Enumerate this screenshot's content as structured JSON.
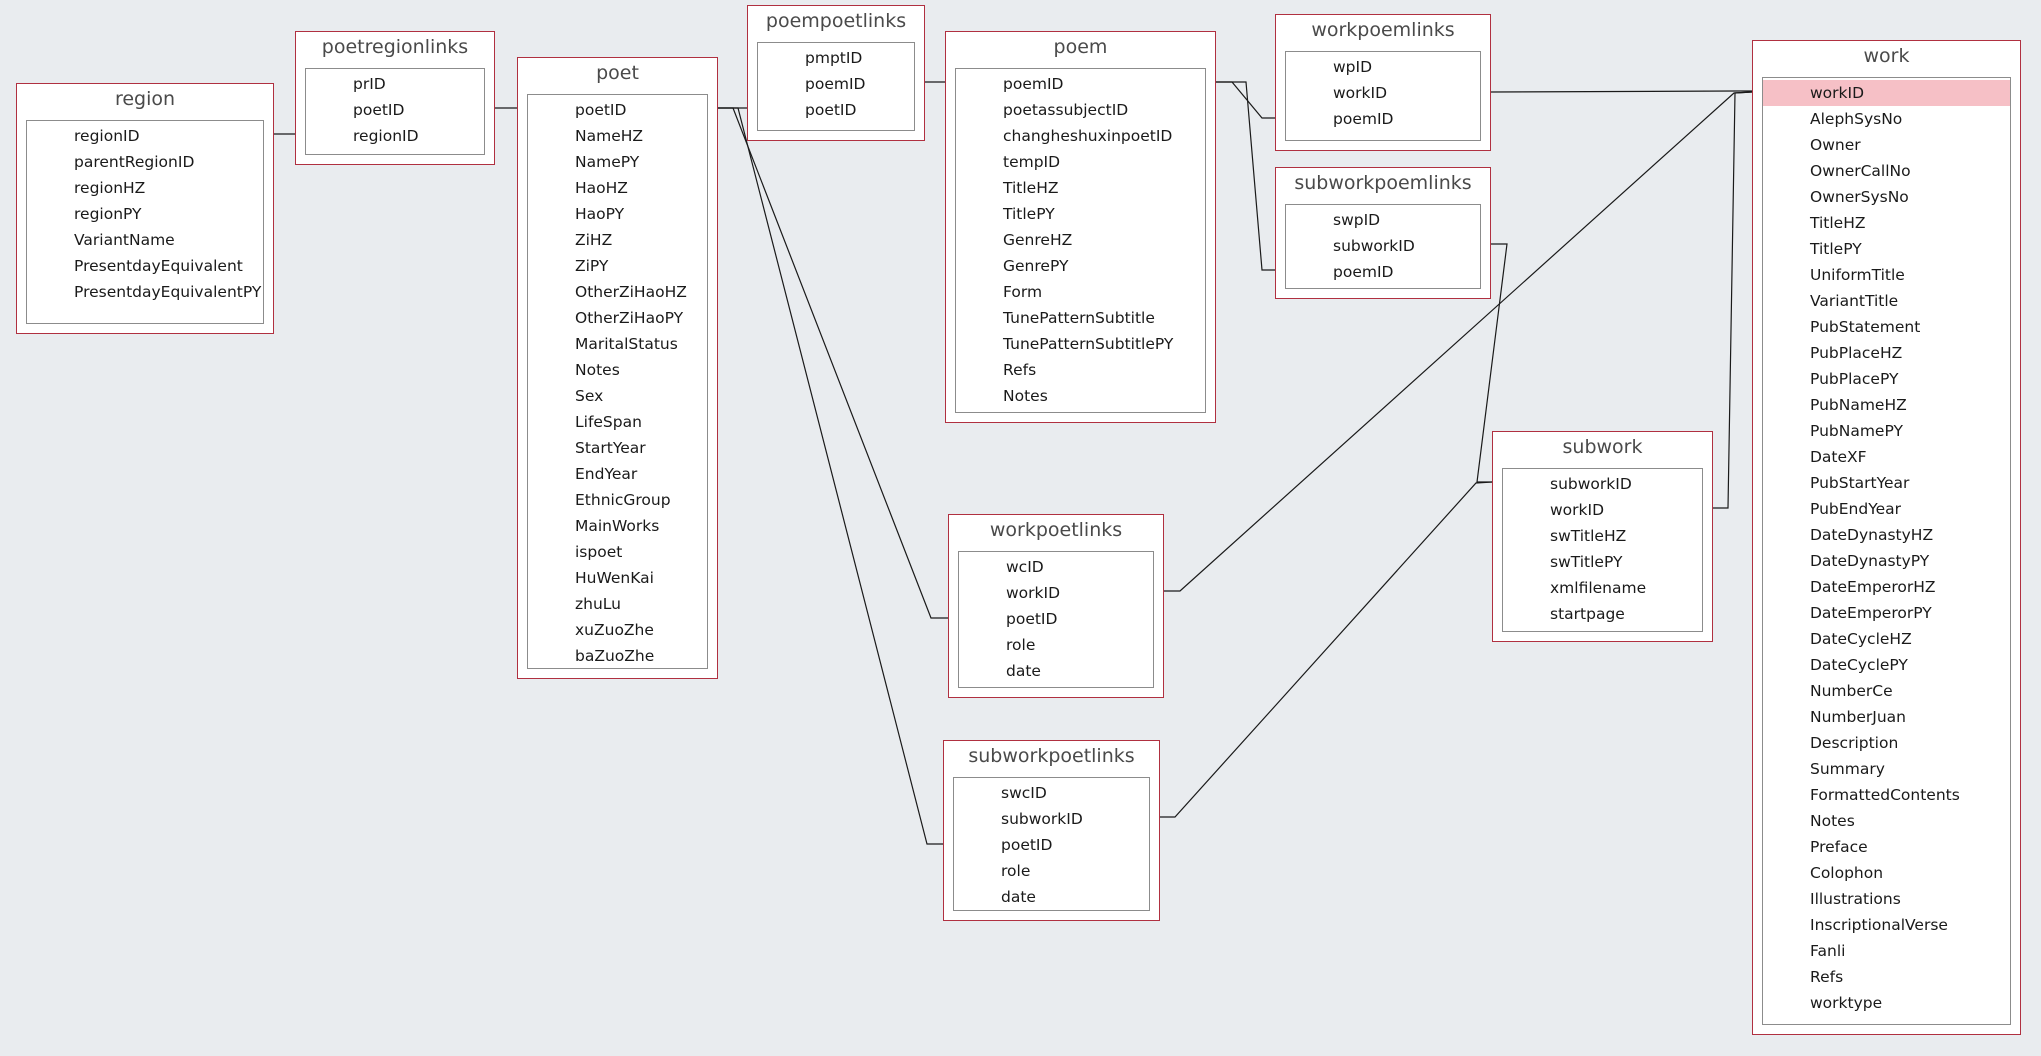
{
  "highlight_color": "#f6c0c6",
  "border_color": "#b03040",
  "tables": {
    "region": {
      "title": "region",
      "fields": [
        "regionID",
        "parentRegionID",
        "regionHZ",
        "regionPY",
        "VariantName",
        "PresentdayEquivalent",
        "PresentdayEquivalentPY"
      ]
    },
    "poetregionlinks": {
      "title": "poetregionlinks",
      "fields": [
        "prID",
        "poetID",
        "regionID"
      ]
    },
    "poet": {
      "title": "poet",
      "fields": [
        "poetID",
        "NameHZ",
        "NamePY",
        "HaoHZ",
        "HaoPY",
        "ZiHZ",
        "ZiPY",
        "OtherZiHaoHZ",
        "OtherZiHaoPY",
        "MaritalStatus",
        "Notes",
        "Sex",
        "LifeSpan",
        "StartYear",
        "EndYear",
        "EthnicGroup",
        "MainWorks",
        "ispoet",
        "HuWenKai",
        "zhuLu",
        "xuZuoZhe",
        "baZuoZhe"
      ]
    },
    "poempoetlinks": {
      "title": "poempoetlinks",
      "fields": [
        "pmptID",
        "poemID",
        "poetID"
      ]
    },
    "poem": {
      "title": "poem",
      "fields": [
        "poemID",
        "poetassubjectID",
        "changheshuxinpoetID",
        "tempID",
        "TitleHZ",
        "TitlePY",
        "GenreHZ",
        "GenrePY",
        "Form",
        "TunePatternSubtitle",
        "TunePatternSubtitlePY",
        "Refs",
        "Notes"
      ]
    },
    "workpoemlinks": {
      "title": "workpoemlinks",
      "fields": [
        "wpID",
        "workID",
        "poemID"
      ]
    },
    "subworkpoemlinks": {
      "title": "subworkpoemlinks",
      "fields": [
        "swpID",
        "subworkID",
        "poemID"
      ]
    },
    "workpoetlinks": {
      "title": "workpoetlinks",
      "fields": [
        "wcID",
        "workID",
        "poetID",
        "role",
        "date"
      ]
    },
    "subworkpoetlinks": {
      "title": "subworkpoetlinks",
      "fields": [
        "swcID",
        "subworkID",
        "poetID",
        "role",
        "date"
      ]
    },
    "subwork": {
      "title": "subwork",
      "fields": [
        "subworkID",
        "workID",
        "swTitleHZ",
        "swTitlePY",
        "xmlfilename",
        "startpage"
      ]
    },
    "work": {
      "title": "work",
      "selected_field": "workID",
      "fields": [
        "workID",
        "AlephSysNo",
        "Owner",
        "OwnerCallNo",
        "OwnerSysNo",
        "TitleHZ",
        "TitlePY",
        "UniformTitle",
        "VariantTitle",
        "PubStatement",
        "PubPlaceHZ",
        "PubPlacePY",
        "PubNameHZ",
        "PubNamePY",
        "DateXF",
        "PubStartYear",
        "PubEndYear",
        "DateDynastyHZ",
        "DateDynastyPY",
        "DateEmperorHZ",
        "DateEmperorPY",
        "DateCycleHZ",
        "DateCyclePY",
        "NumberCe",
        "NumberJuan",
        "Description",
        "Summary",
        "FormattedContents",
        "Notes",
        "Preface",
        "Colophon",
        "Illustrations",
        "InscriptionalVerse",
        "Fanli",
        "Refs",
        "worktype"
      ]
    }
  }
}
